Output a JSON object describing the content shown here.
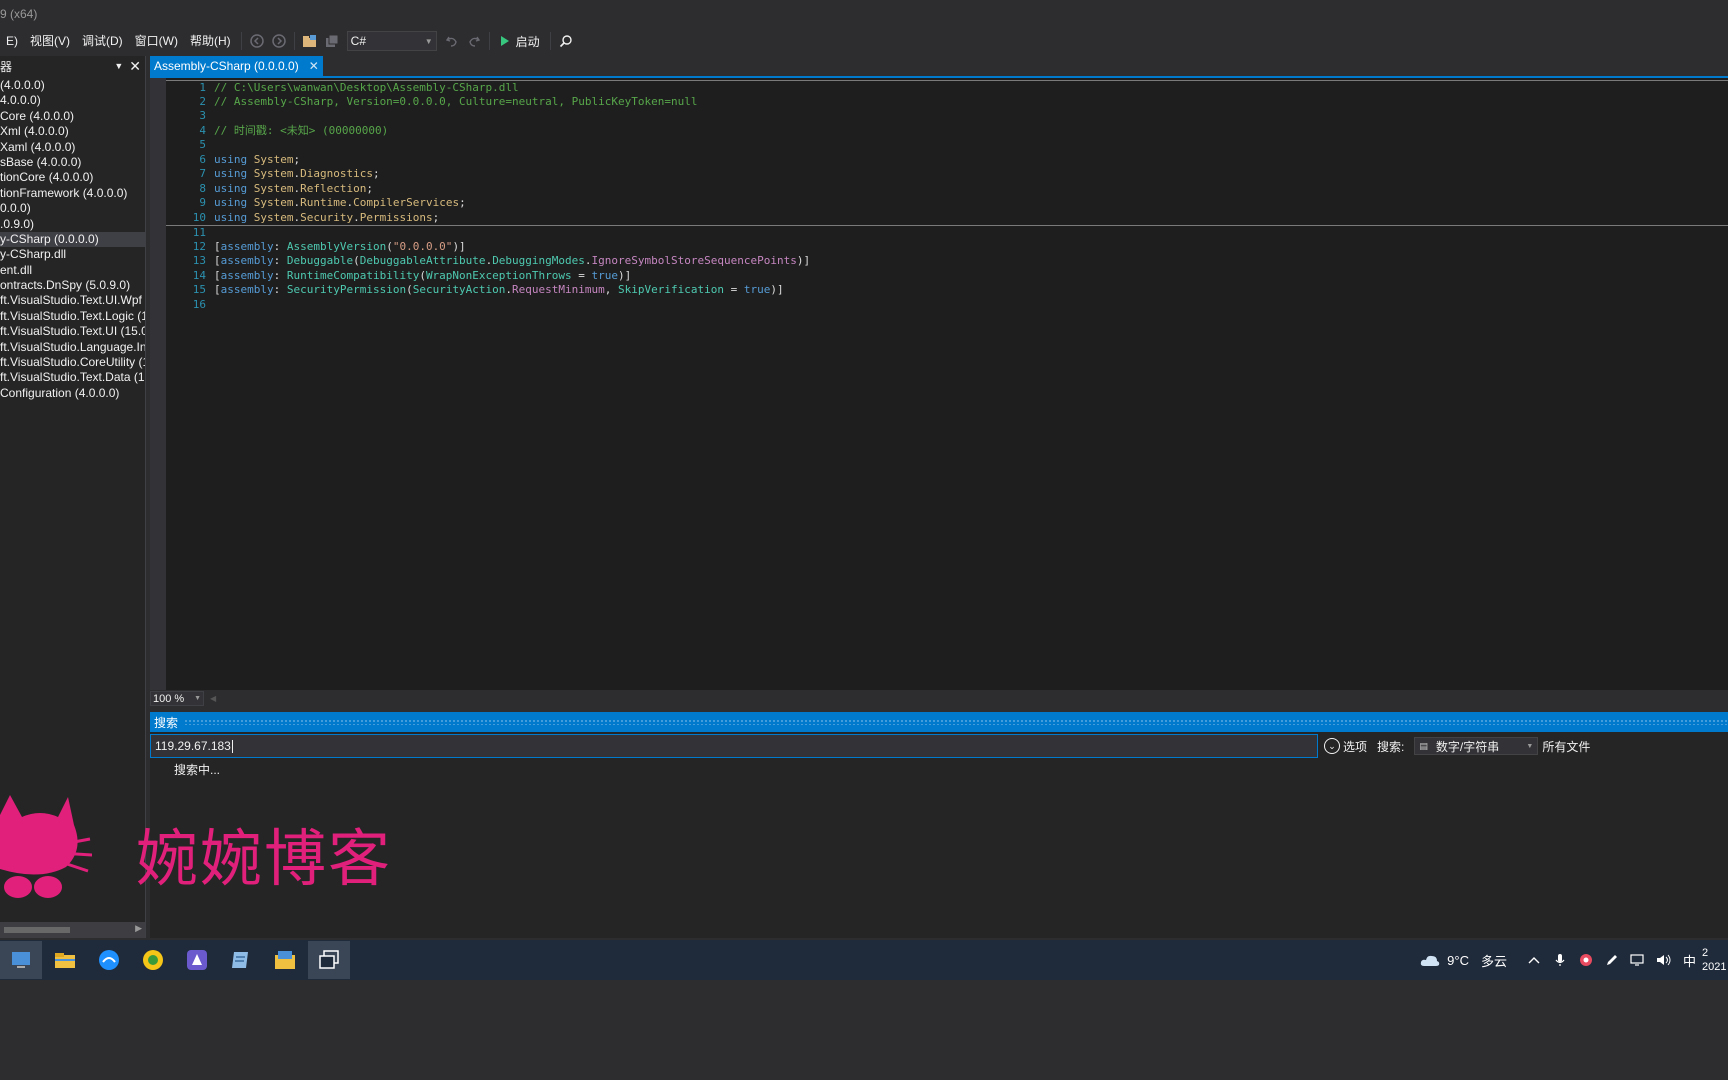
{
  "window": {
    "title": "9 (x64)"
  },
  "menu": [
    "E)",
    "视图(V)",
    "调试(D)",
    "窗口(W)",
    "帮助(H)"
  ],
  "toolbar": {
    "language": "C#",
    "start_label": "启动"
  },
  "explorer": {
    "title": "器",
    "items": [
      {
        "label": " (4.0.0.0)",
        "selected": false
      },
      {
        "label": "4.0.0.0)",
        "selected": false
      },
      {
        "label": "Core (4.0.0.0)",
        "selected": false
      },
      {
        "label": "Xml (4.0.0.0)",
        "selected": false
      },
      {
        "label": "Xaml (4.0.0.0)",
        "selected": false
      },
      {
        "label": "sBase (4.0.0.0)",
        "selected": false
      },
      {
        "label": "tionCore (4.0.0.0)",
        "selected": false
      },
      {
        "label": "tionFramework (4.0.0.0)",
        "selected": false
      },
      {
        "label": "0.0.0)",
        "selected": false
      },
      {
        "label": ".0.9.0)",
        "selected": false
      },
      {
        "label": "y-CSharp (0.0.0.0)",
        "selected": true
      },
      {
        "label": "y-CSharp.dll",
        "selected": false
      },
      {
        "label": "ent.dll",
        "selected": false
      },
      {
        "label": "ontracts.DnSpy (5.0.9.0)",
        "selected": false
      },
      {
        "label": "ft.VisualStudio.Text.UI.Wpf (",
        "selected": false
      },
      {
        "label": "ft.VisualStudio.Text.Logic (15",
        "selected": false
      },
      {
        "label": "ft.VisualStudio.Text.UI (15.0.",
        "selected": false
      },
      {
        "label": "ft.VisualStudio.Language.Int",
        "selected": false
      },
      {
        "label": "ft.VisualStudio.CoreUtility (1",
        "selected": false
      },
      {
        "label": "ft.VisualStudio.Text.Data (15",
        "selected": false
      },
      {
        "label": "Configuration (4.0.0.0)",
        "selected": false
      }
    ]
  },
  "document_tab": {
    "label": "Assembly-CSharp (0.0.0.0)"
  },
  "editor": {
    "lines": [
      {
        "n": "1",
        "tokens": [
          [
            "cm",
            "// C:\\Users\\wanwan\\Desktop\\Assembly-CSharp.dll"
          ]
        ]
      },
      {
        "n": "2",
        "tokens": [
          [
            "cm",
            "// Assembly-CSharp, Version=0.0.0.0, Culture=neutral, PublicKeyToken=null"
          ]
        ]
      },
      {
        "n": "3",
        "tokens": []
      },
      {
        "n": "4",
        "tokens": [
          [
            "cm",
            "// 时间戳: <未知> (00000000)"
          ]
        ]
      },
      {
        "n": "5",
        "tokens": []
      },
      {
        "n": "6",
        "tokens": [
          [
            "kw",
            "using"
          ],
          [
            "pl",
            " "
          ],
          [
            "ns",
            "System"
          ],
          [
            "pl",
            ";"
          ]
        ]
      },
      {
        "n": "7",
        "tokens": [
          [
            "kw",
            "using"
          ],
          [
            "pl",
            " "
          ],
          [
            "ns",
            "System"
          ],
          [
            "pl",
            "."
          ],
          [
            "ns",
            "Diagnostics"
          ],
          [
            "pl",
            ";"
          ]
        ]
      },
      {
        "n": "8",
        "tokens": [
          [
            "kw",
            "using"
          ],
          [
            "pl",
            " "
          ],
          [
            "ns",
            "System"
          ],
          [
            "pl",
            "."
          ],
          [
            "ns",
            "Reflection"
          ],
          [
            "pl",
            ";"
          ]
        ]
      },
      {
        "n": "9",
        "tokens": [
          [
            "kw",
            "using"
          ],
          [
            "pl",
            " "
          ],
          [
            "ns",
            "System"
          ],
          [
            "pl",
            "."
          ],
          [
            "ns",
            "Runtime"
          ],
          [
            "pl",
            "."
          ],
          [
            "ns",
            "CompilerServices"
          ],
          [
            "pl",
            ";"
          ]
        ]
      },
      {
        "n": "10",
        "tokens": [
          [
            "kw",
            "using"
          ],
          [
            "pl",
            " "
          ],
          [
            "ns",
            "System"
          ],
          [
            "pl",
            "."
          ],
          [
            "ns",
            "Security"
          ],
          [
            "pl",
            "."
          ],
          [
            "ns",
            "Permissions"
          ],
          [
            "pl",
            ";"
          ]
        ]
      },
      {
        "n": "11",
        "tokens": []
      },
      {
        "n": "12",
        "tokens": [
          [
            "pl",
            "["
          ],
          [
            "kw",
            "assembly"
          ],
          [
            "pl",
            ": "
          ],
          [
            "ty",
            "AssemblyVersion"
          ],
          [
            "pl",
            "("
          ],
          [
            "st",
            "\"0.0.0.0\""
          ],
          [
            "pl",
            ")]"
          ]
        ]
      },
      {
        "n": "13",
        "tokens": [
          [
            "pl",
            "["
          ],
          [
            "kw",
            "assembly"
          ],
          [
            "pl",
            ": "
          ],
          [
            "ty",
            "Debuggable"
          ],
          [
            "pl",
            "("
          ],
          [
            "ty",
            "DebuggableAttribute"
          ],
          [
            "pl",
            "."
          ],
          [
            "ty",
            "DebuggingModes"
          ],
          [
            "pl",
            "."
          ],
          [
            "ce",
            "IgnoreSymbolStoreSequencePoints"
          ],
          [
            "pl",
            ")]"
          ]
        ]
      },
      {
        "n": "14",
        "tokens": [
          [
            "pl",
            "["
          ],
          [
            "kw",
            "assembly"
          ],
          [
            "pl",
            ": "
          ],
          [
            "ty",
            "RuntimeCompatibility"
          ],
          [
            "pl",
            "("
          ],
          [
            "fd",
            "WrapNonExceptionThrows"
          ],
          [
            "pl",
            " = "
          ],
          [
            "kw",
            "true"
          ],
          [
            "pl",
            ")]"
          ]
        ]
      },
      {
        "n": "15",
        "tokens": [
          [
            "pl",
            "["
          ],
          [
            "kw",
            "assembly"
          ],
          [
            "pl",
            ": "
          ],
          [
            "ty",
            "SecurityPermission"
          ],
          [
            "pl",
            "("
          ],
          [
            "ty",
            "SecurityAction"
          ],
          [
            "pl",
            "."
          ],
          [
            "ce",
            "RequestMinimum"
          ],
          [
            "pl",
            ", "
          ],
          [
            "fd",
            "SkipVerification"
          ],
          [
            "pl",
            " = "
          ],
          [
            "kw",
            "true"
          ],
          [
            "pl",
            ")]"
          ]
        ]
      },
      {
        "n": "16",
        "tokens": []
      }
    ],
    "zoom": "100 %"
  },
  "search_panel": {
    "title": "搜索",
    "query": "119.29.67.183",
    "options_label": "选项",
    "search_label": "搜索:",
    "search_type": "数字/字符串",
    "scope": "所有文件",
    "status": "搜索中..."
  },
  "watermark": {
    "text": "婉婉博客",
    "color": "#e0207a"
  },
  "taskbar": {
    "apps": [
      "monitor-app-icon",
      "file-explorer-icon",
      "browser-app-icon",
      "kiwi-app-icon",
      "blue-app-icon",
      "notepad-app-icon",
      "folder-app-icon",
      "task-view-icon"
    ],
    "weather": {
      "temp": "9°C",
      "desc": "多云"
    },
    "ime": "中",
    "clock_time": "2",
    "clock_date": "2021"
  },
  "colors": {
    "accent": "#007acc",
    "background": "#1e1e1e"
  }
}
